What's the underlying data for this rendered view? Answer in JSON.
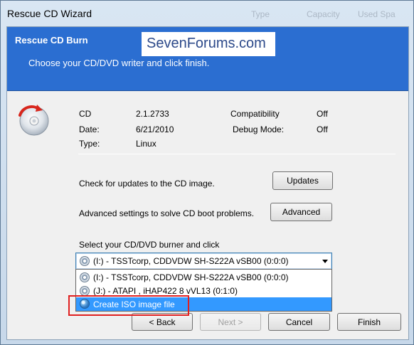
{
  "window": {
    "title": "Rescue CD Wizard",
    "background_columns": [
      "Type",
      "Capacity",
      "Used Spa"
    ]
  },
  "header": {
    "title": "Rescue CD Burn",
    "subtitle": "Choose your CD/DVD writer and click finish.",
    "watermark": "SevenForums.com"
  },
  "info": {
    "cd_label": "CD",
    "cd_value": "2.1.2733",
    "date_label": "Date:",
    "date_value": "6/21/2010",
    "type_label": "Type:",
    "type_value": "Linux",
    "compat_label": "Compatibility",
    "compat_value": "Off",
    "debug_label": "Debug Mode:",
    "debug_value": "Off"
  },
  "updates": {
    "text": "Check for updates to the CD image.",
    "button": "Updates"
  },
  "advanced": {
    "text": "Advanced settings to solve CD boot problems.",
    "button": "Advanced"
  },
  "burner": {
    "label": "Select your CD/DVD burner and click",
    "selected": "(I:) - TSSTcorp, CDDVDW SH-S222A  vSB00 (0:0:0)",
    "options": [
      "(I:) - TSSTcorp, CDDVDW SH-S222A  vSB00 (0:0:0)",
      "(J:) - ATAPI   , iHAP422   8     vVL13 (0:1:0)",
      "Create ISO image file"
    ]
  },
  "footer": {
    "back": "< Back",
    "next": "Next >",
    "cancel": "Cancel",
    "finish": "Finish"
  },
  "colors": {
    "header_bg": "#2b6ed1",
    "selection": "#3399ff",
    "highlight_box": "#e02020"
  }
}
